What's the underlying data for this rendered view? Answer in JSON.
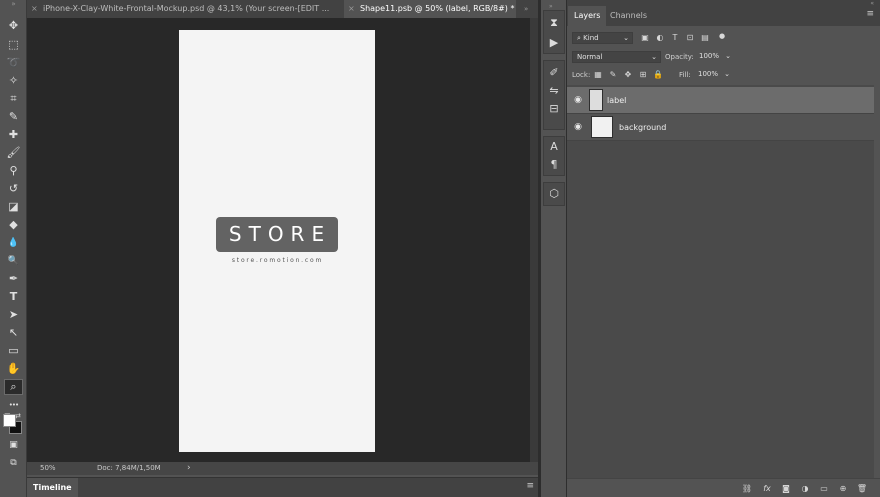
{
  "tabs": [
    {
      "label": "iPhone-X-Clay-White-Frontal-Mockup.psd @ 43,1% (Your screen-[EDIT ...",
      "close": "×"
    },
    {
      "label": "Shape11.psb @ 50% (label, RGB/8#) *",
      "close": "×"
    }
  ],
  "canvas": {
    "logo_text": "STORE",
    "logo_url": "store.romotion.com"
  },
  "status": {
    "zoom": "50%",
    "doc": "Doc: 7,84M/1,50M",
    "arrow": "›"
  },
  "timeline": {
    "label": "Timeline",
    "menu": "≡"
  },
  "toolbar": {
    "tools": [
      {
        "name": "move-tool",
        "glyph": "✥"
      },
      {
        "name": "marquee-tool",
        "glyph": "⬚"
      },
      {
        "name": "lasso-tool",
        "glyph": "➰"
      },
      {
        "name": "magic-wand-tool",
        "glyph": "✧"
      },
      {
        "name": "crop-tool",
        "glyph": "⌗"
      },
      {
        "name": "eyedropper-tool",
        "glyph": "✎"
      },
      {
        "name": "healing-brush-tool",
        "glyph": "✚"
      },
      {
        "name": "brush-tool",
        "glyph": "🖌"
      },
      {
        "name": "stamp-tool",
        "glyph": "⚲"
      },
      {
        "name": "history-brush-tool",
        "glyph": "↺"
      },
      {
        "name": "eraser-tool",
        "glyph": "◪"
      },
      {
        "name": "paint-bucket-tool",
        "glyph": "◆"
      },
      {
        "name": "blur-tool",
        "glyph": "💧"
      },
      {
        "name": "dodge-tool",
        "glyph": "🔍"
      },
      {
        "name": "pen-tool",
        "glyph": "✒"
      },
      {
        "name": "type-tool",
        "glyph": "T"
      },
      {
        "name": "path-selection-tool",
        "glyph": "➤"
      },
      {
        "name": "direct-selection-tool",
        "glyph": "↖"
      },
      {
        "name": "rectangle-tool",
        "glyph": "▭"
      },
      {
        "name": "hand-tool",
        "glyph": "✋"
      },
      {
        "name": "zoom-tool",
        "glyph": "⌕"
      },
      {
        "name": "more-tools",
        "glyph": "•••"
      }
    ]
  },
  "panel": {
    "tabs": [
      "Layers",
      "Channels"
    ],
    "menu": "≡",
    "collapse": "«",
    "filter_kind": "Kind",
    "blend_mode": "Normal",
    "opacity_label": "Opacity:",
    "opacity_value": "100%",
    "lock_label": "Lock:",
    "fill_label": "Fill:",
    "fill_value": "100%",
    "layers": [
      {
        "name": "label",
        "selected": true
      },
      {
        "name": "background",
        "selected": false
      }
    ]
  },
  "colors": {
    "panel_bg": "#535353",
    "canvas_bg": "#282828",
    "artboard": "#f4f4f4",
    "badge": "#636363",
    "selected_layer": "#6c6c6c"
  }
}
